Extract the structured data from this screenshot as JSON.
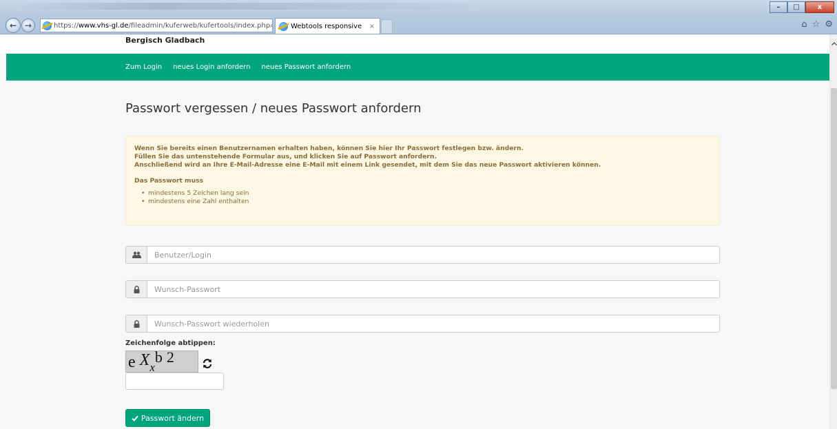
{
  "browser": {
    "url_protocol": "https://",
    "url_domain": "www.vhs-gl.de",
    "url_path": "/fileadmin/kuferweb/kufertools/index.php",
    "tab_title": "Webtools responsive",
    "tab_close": "×",
    "search_glyph": "⌕",
    "dropdown_glyph": "▾",
    "lock_glyph": "🔒",
    "refresh_glyph": "↻",
    "minimize": "–",
    "maximize": "□",
    "close": "x",
    "back_glyph": "←",
    "forward_glyph": "→",
    "home_glyph": "⌂",
    "favorites_glyph": "☆",
    "tools_glyph": "⚙"
  },
  "site": {
    "name": "Bergisch Gladbach",
    "nav": [
      {
        "label": "Zum Login"
      },
      {
        "label": "neues Login anfordern"
      },
      {
        "label": "neues Passwort anfordern"
      }
    ]
  },
  "main": {
    "title": "Passwort vergessen / neues Passwort anfordern",
    "alert": {
      "lines": [
        "Wenn Sie bereits einen Benutzernamen erhalten haben, können Sie hier Ihr Passwort festlegen bzw. ändern.",
        "Füllen Sie das untenstehende Formular aus, und klicken Sie auf Passwort anfordern.",
        "Anschließend wird an Ihre E-Mail-Adresse eine E-Mail mit einem Link gesendet, mit dem Sie das neue Passwort aktivieren können."
      ],
      "requirements_title": "Das Passwort muss",
      "requirements": [
        "mindestens 5 Zeichen lang sein",
        "mindestens eine Zahl enthalten"
      ]
    },
    "form": {
      "user_placeholder": "Benutzer/Login",
      "password_placeholder": "Wunsch-Passwort",
      "password_repeat_placeholder": "Wunsch-Passwort wiederholen",
      "captcha_label": "Zeichenfolge abtippen:",
      "captcha_chars": [
        "e",
        "X",
        "x",
        "b",
        "2"
      ],
      "captcha_value": "",
      "submit_label": "Passwort ändern"
    }
  },
  "colors": {
    "accent": "#00a57e",
    "alert_bg": "#fcf8e3",
    "alert_border": "#faebcc",
    "alert_text": "#8a6d3b"
  }
}
